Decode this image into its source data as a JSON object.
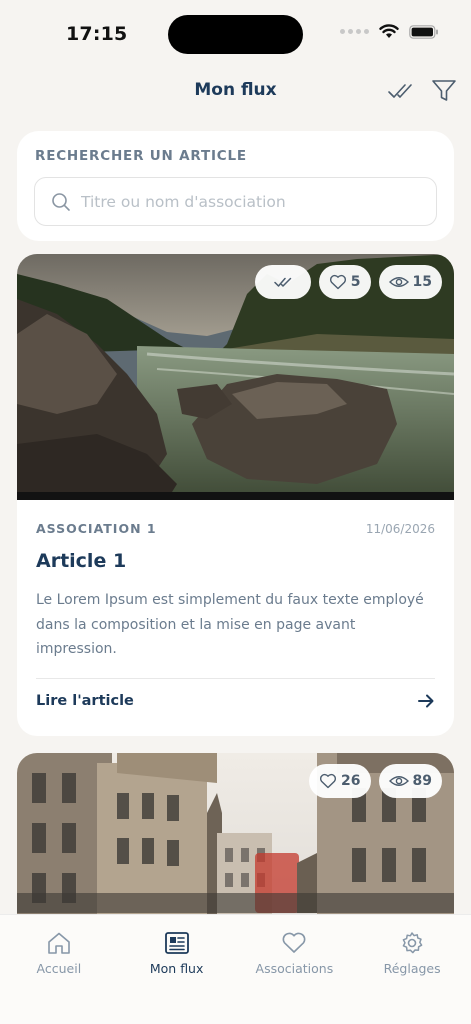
{
  "status_bar": {
    "time": "17:15"
  },
  "header": {
    "title": "Mon flux"
  },
  "search": {
    "label": "RECHERCHER UN ARTICLE",
    "placeholder": "Titre ou nom d'association"
  },
  "articles": [
    {
      "association": "ASSOCIATION 1",
      "date": "11/06/2026",
      "title": "Article 1",
      "excerpt": "Le Lorem Ipsum est simplement du faux texte employé dans la composition et la mise en page avant impression.",
      "link_label": "Lire l'article",
      "likes": "5",
      "views": "15",
      "read": true
    },
    {
      "likes": "26",
      "views": "89",
      "read": false
    }
  ],
  "tabs": [
    {
      "label": "Accueil",
      "icon": "home-icon"
    },
    {
      "label": "Mon flux",
      "icon": "newspaper-icon",
      "active": true
    },
    {
      "label": "Associations",
      "icon": "heart-icon"
    },
    {
      "label": "Réglages",
      "icon": "gear-icon"
    }
  ],
  "colors": {
    "primary": "#1d3a5a",
    "muted": "#6b7c8e",
    "background": "#f6f4f1"
  }
}
